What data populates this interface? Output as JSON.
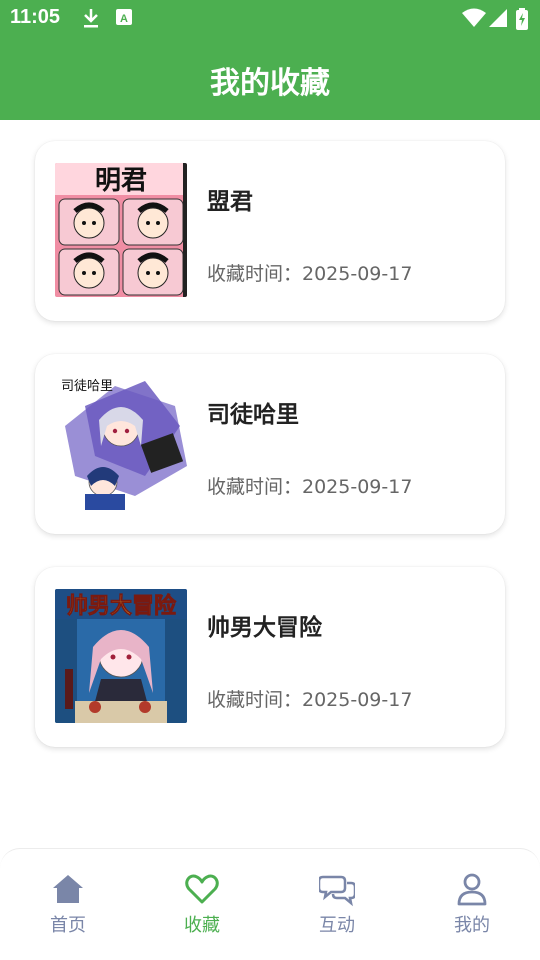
{
  "status_bar": {
    "time": "11:05",
    "icons": [
      "download-icon",
      "a-icon",
      "wifi-icon",
      "signal-icon",
      "battery-icon"
    ]
  },
  "header": {
    "title": "我的收藏"
  },
  "favorites": [
    {
      "title": "盟君",
      "date": "收藏时间：2025-09-17",
      "cover": "cover-manga-1"
    },
    {
      "title": "司徒哈里",
      "date": "收藏时间：2025-09-17",
      "cover": "cover-manga-2"
    },
    {
      "title": "帅男大冒险",
      "date": "收藏时间：2025-09-17",
      "cover": "cover-manga-3"
    }
  ],
  "nav": {
    "items": [
      {
        "label": "首页",
        "icon": "home-icon",
        "active": false
      },
      {
        "label": "收藏",
        "icon": "heart-icon",
        "active": true
      },
      {
        "label": "互动",
        "icon": "chat-icon",
        "active": false
      },
      {
        "label": "我的",
        "icon": "user-icon",
        "active": false
      }
    ],
    "active_color": "#4caf50",
    "inactive_color": "#7a86a8"
  },
  "colors": {
    "brand": "#4caf50",
    "text_primary": "#222222",
    "text_secondary": "#666666"
  }
}
